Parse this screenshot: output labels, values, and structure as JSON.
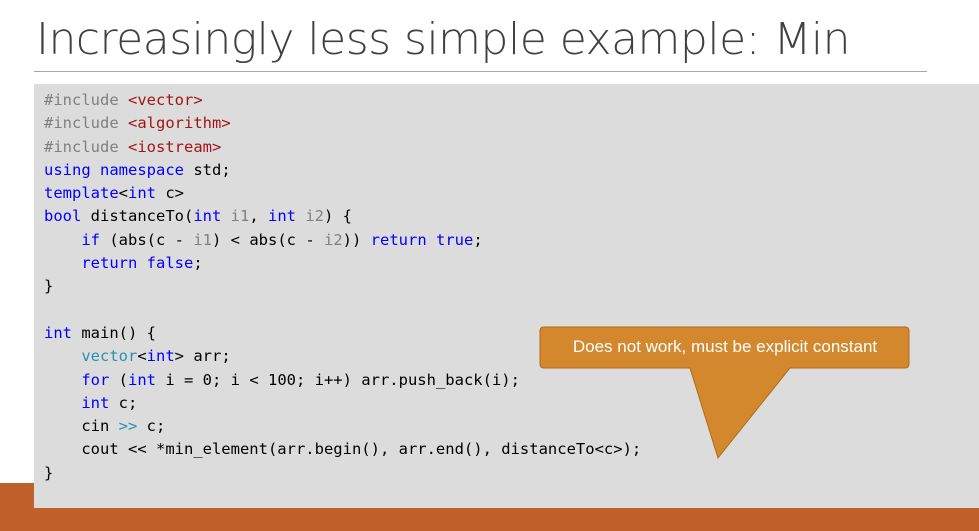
{
  "slide": {
    "title": "Increasingly less simple example: Min",
    "callout_text": "Does not work, must be explicit constant"
  },
  "colors": {
    "title_text": "#404040",
    "code_background": "#dcdcdc",
    "accent_bar": "#c0602a",
    "callout_fill": "#d4882e",
    "keyword": "#0000ff",
    "string": "#a31515",
    "type": "#2b91af",
    "preprocessor": "#808080"
  },
  "code": {
    "lines": [
      [
        {
          "t": "pre",
          "v": "#include "
        },
        {
          "t": "str",
          "v": "<vector>"
        }
      ],
      [
        {
          "t": "pre",
          "v": "#include "
        },
        {
          "t": "str",
          "v": "<algorithm>"
        }
      ],
      [
        {
          "t": "pre",
          "v": "#include "
        },
        {
          "t": "str",
          "v": "<iostream>"
        }
      ],
      [
        {
          "t": "kw",
          "v": "using"
        },
        {
          "t": "plain",
          "v": " "
        },
        {
          "t": "kw",
          "v": "namespace"
        },
        {
          "t": "plain",
          "v": " std;"
        }
      ],
      [
        {
          "t": "kw",
          "v": "template"
        },
        {
          "t": "plain",
          "v": "<"
        },
        {
          "t": "kw",
          "v": "int"
        },
        {
          "t": "plain",
          "v": " c>"
        }
      ],
      [
        {
          "t": "kw",
          "v": "bool"
        },
        {
          "t": "plain",
          "v": " distanceTo("
        },
        {
          "t": "kw",
          "v": "int"
        },
        {
          "t": "plain",
          "v": " "
        },
        {
          "t": "param",
          "v": "i1"
        },
        {
          "t": "plain",
          "v": ", "
        },
        {
          "t": "kw",
          "v": "int"
        },
        {
          "t": "plain",
          "v": " "
        },
        {
          "t": "param",
          "v": "i2"
        },
        {
          "t": "plain",
          "v": ") {"
        }
      ],
      [
        {
          "t": "plain",
          "v": "    "
        },
        {
          "t": "kw",
          "v": "if"
        },
        {
          "t": "plain",
          "v": " (abs(c - "
        },
        {
          "t": "param",
          "v": "i1"
        },
        {
          "t": "plain",
          "v": ") < abs(c - "
        },
        {
          "t": "param",
          "v": "i2"
        },
        {
          "t": "plain",
          "v": ")) "
        },
        {
          "t": "kw",
          "v": "return"
        },
        {
          "t": "plain",
          "v": " "
        },
        {
          "t": "kw",
          "v": "true"
        },
        {
          "t": "plain",
          "v": ";"
        }
      ],
      [
        {
          "t": "plain",
          "v": "    "
        },
        {
          "t": "kw",
          "v": "return"
        },
        {
          "t": "plain",
          "v": " "
        },
        {
          "t": "kw",
          "v": "false"
        },
        {
          "t": "plain",
          "v": ";"
        }
      ],
      [
        {
          "t": "plain",
          "v": "}"
        }
      ],
      [
        {
          "t": "plain",
          "v": ""
        }
      ],
      [
        {
          "t": "kw",
          "v": "int"
        },
        {
          "t": "plain",
          "v": " main() {"
        }
      ],
      [
        {
          "t": "plain",
          "v": "    "
        },
        {
          "t": "type",
          "v": "vector"
        },
        {
          "t": "plain",
          "v": "<"
        },
        {
          "t": "kw",
          "v": "int"
        },
        {
          "t": "plain",
          "v": "> arr;"
        }
      ],
      [
        {
          "t": "plain",
          "v": "    "
        },
        {
          "t": "kw",
          "v": "for"
        },
        {
          "t": "plain",
          "v": " ("
        },
        {
          "t": "kw",
          "v": "int"
        },
        {
          "t": "plain",
          "v": " i = 0; i < 100; i++) arr.push_back(i);"
        }
      ],
      [
        {
          "t": "plain",
          "v": "    "
        },
        {
          "t": "kw",
          "v": "int"
        },
        {
          "t": "plain",
          "v": " c;"
        }
      ],
      [
        {
          "t": "plain",
          "v": "    cin "
        },
        {
          "t": "type",
          "v": ">>"
        },
        {
          "t": "plain",
          "v": " c;"
        }
      ],
      [
        {
          "t": "plain",
          "v": "    cout << *min_element(arr.begin(), arr.end(), distanceTo<c>);"
        }
      ],
      [
        {
          "t": "plain",
          "v": "}"
        }
      ]
    ]
  }
}
